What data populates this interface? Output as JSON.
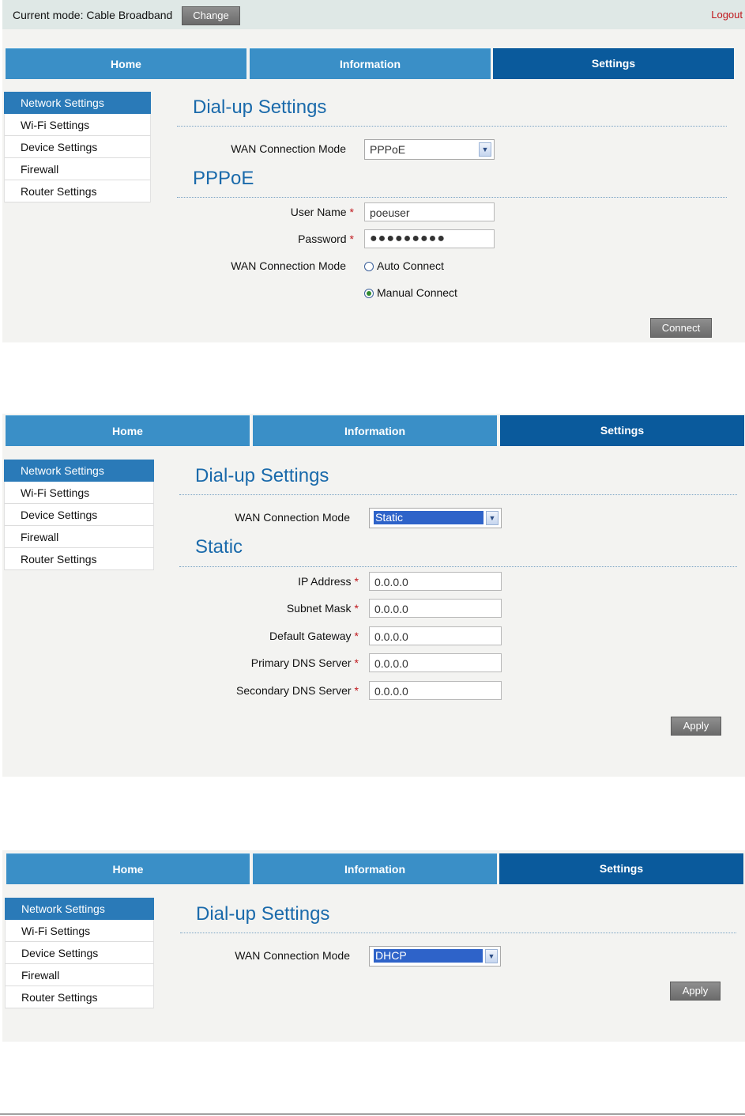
{
  "topbar": {
    "mode_text": "Current mode: Cable Broadband",
    "change_label": "Change",
    "logout_label": "Logout"
  },
  "tabs": {
    "home": "Home",
    "information": "Information",
    "settings": "Settings"
  },
  "sidebar": {
    "items": [
      {
        "label": "Network Settings",
        "active": true
      },
      {
        "label": "Wi-Fi Settings"
      },
      {
        "label": "Device Settings"
      },
      {
        "label": "Firewall"
      },
      {
        "label": "Router Settings"
      }
    ]
  },
  "panel1": {
    "title": "Dial-up Settings",
    "wan_label": "WAN Connection Mode",
    "wan_value": "PPPoE",
    "section_title": "PPPoE",
    "username_label": "User Name",
    "username_value": "poeuser",
    "password_label": "Password",
    "password_value": "●●●●●●●●●",
    "mode_label": "WAN Connection Mode",
    "auto_label": "Auto Connect",
    "manual_label": "Manual Connect",
    "selected_mode": "Manual Connect",
    "connect_label": "Connect"
  },
  "panel2": {
    "title": "Dial-up Settings",
    "wan_label": "WAN Connection Mode",
    "wan_value": "Static",
    "section_title": "Static",
    "fields": [
      {
        "label": "IP Address",
        "value": "0.0.0.0"
      },
      {
        "label": "Subnet Mask",
        "value": "0.0.0.0"
      },
      {
        "label": "Default Gateway",
        "value": "0.0.0.0"
      },
      {
        "label": "Primary DNS Server",
        "value": "0.0.0.0"
      },
      {
        "label": "Secondary DNS Server",
        "value": "0.0.0.0"
      }
    ],
    "apply_label": "Apply"
  },
  "panel3": {
    "title": "Dial-up Settings",
    "wan_label": "WAN Connection Mode",
    "wan_value": "DHCP",
    "apply_label": "Apply"
  },
  "required_mark": "*",
  "colors": {
    "accent_dark": "#0a5a9c",
    "accent_light": "#3a8fc7",
    "required": "#c0161b",
    "heading": "#1a6aab"
  }
}
